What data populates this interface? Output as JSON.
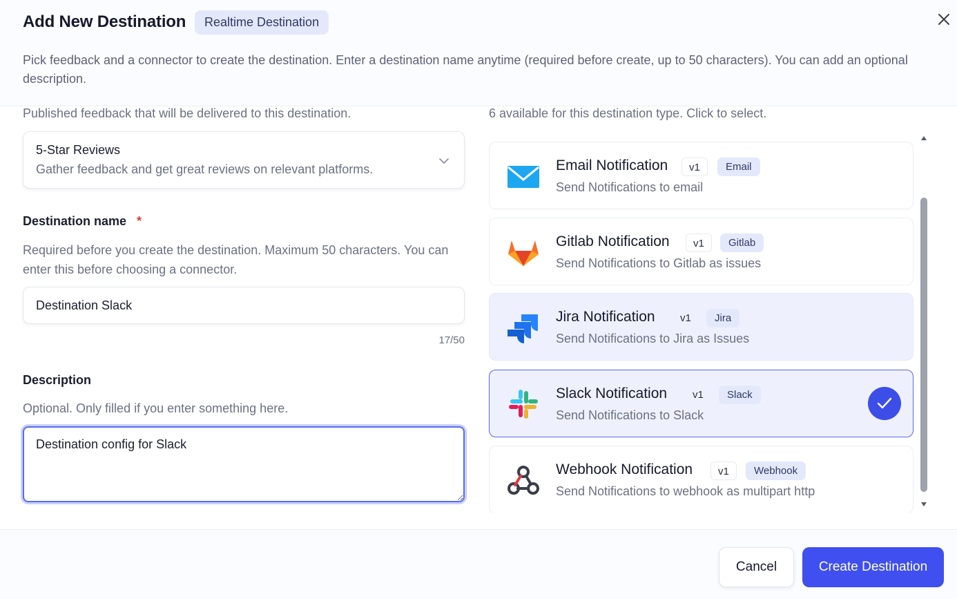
{
  "header": {
    "title": "Add New Destination",
    "type_badge": "Realtime Destination",
    "subtitle": "Pick feedback and a connector to create the destination. Enter a destination name anytime (required before create, up to 50 characters). You can add an optional description."
  },
  "feedback": {
    "helper": "Published feedback that will be delivered to this destination.",
    "selected_title": "5-Star Reviews",
    "selected_desc": "Gather feedback and get great reviews on relevant platforms."
  },
  "name_field": {
    "label": "Destination name",
    "required_mark": "*",
    "helper": "Required before you create the destination. Maximum 50 characters. You can enter this before choosing a connector.",
    "value": "Destination Slack",
    "counter": "17/50"
  },
  "description_field": {
    "label": "Description",
    "helper": "Optional. Only filled if you enter something here.",
    "value": "Destination config for Slack"
  },
  "connectors": {
    "helper": "6 available for this destination type. Click to select.",
    "items": [
      {
        "title": "Email Notification",
        "version": "v1",
        "tag": "Email",
        "desc": "Send Notifications to email",
        "icon": "email-icon"
      },
      {
        "title": "Gitlab Notification",
        "version": "v1",
        "tag": "Gitlab",
        "desc": "Send Notifications to Gitlab as issues",
        "icon": "gitlab-icon"
      },
      {
        "title": "Jira Notification",
        "version": "v1",
        "tag": "Jira",
        "desc": "Send Notifications to Jira as Issues",
        "icon": "jira-icon"
      },
      {
        "title": "Slack Notification",
        "version": "v1",
        "tag": "Slack",
        "desc": "Send Notifications to Slack",
        "icon": "slack-icon",
        "selected": true
      },
      {
        "title": "Webhook Notification",
        "version": "v1",
        "tag": "Webhook",
        "desc": "Send Notifications to webhook as multipart http",
        "icon": "webhook-icon"
      }
    ]
  },
  "footer": {
    "cancel_label": "Cancel",
    "create_label": "Create Destination"
  },
  "colors": {
    "primary": "#3f4ff0",
    "selected_border": "#5865e8",
    "required": "#e0393e"
  }
}
